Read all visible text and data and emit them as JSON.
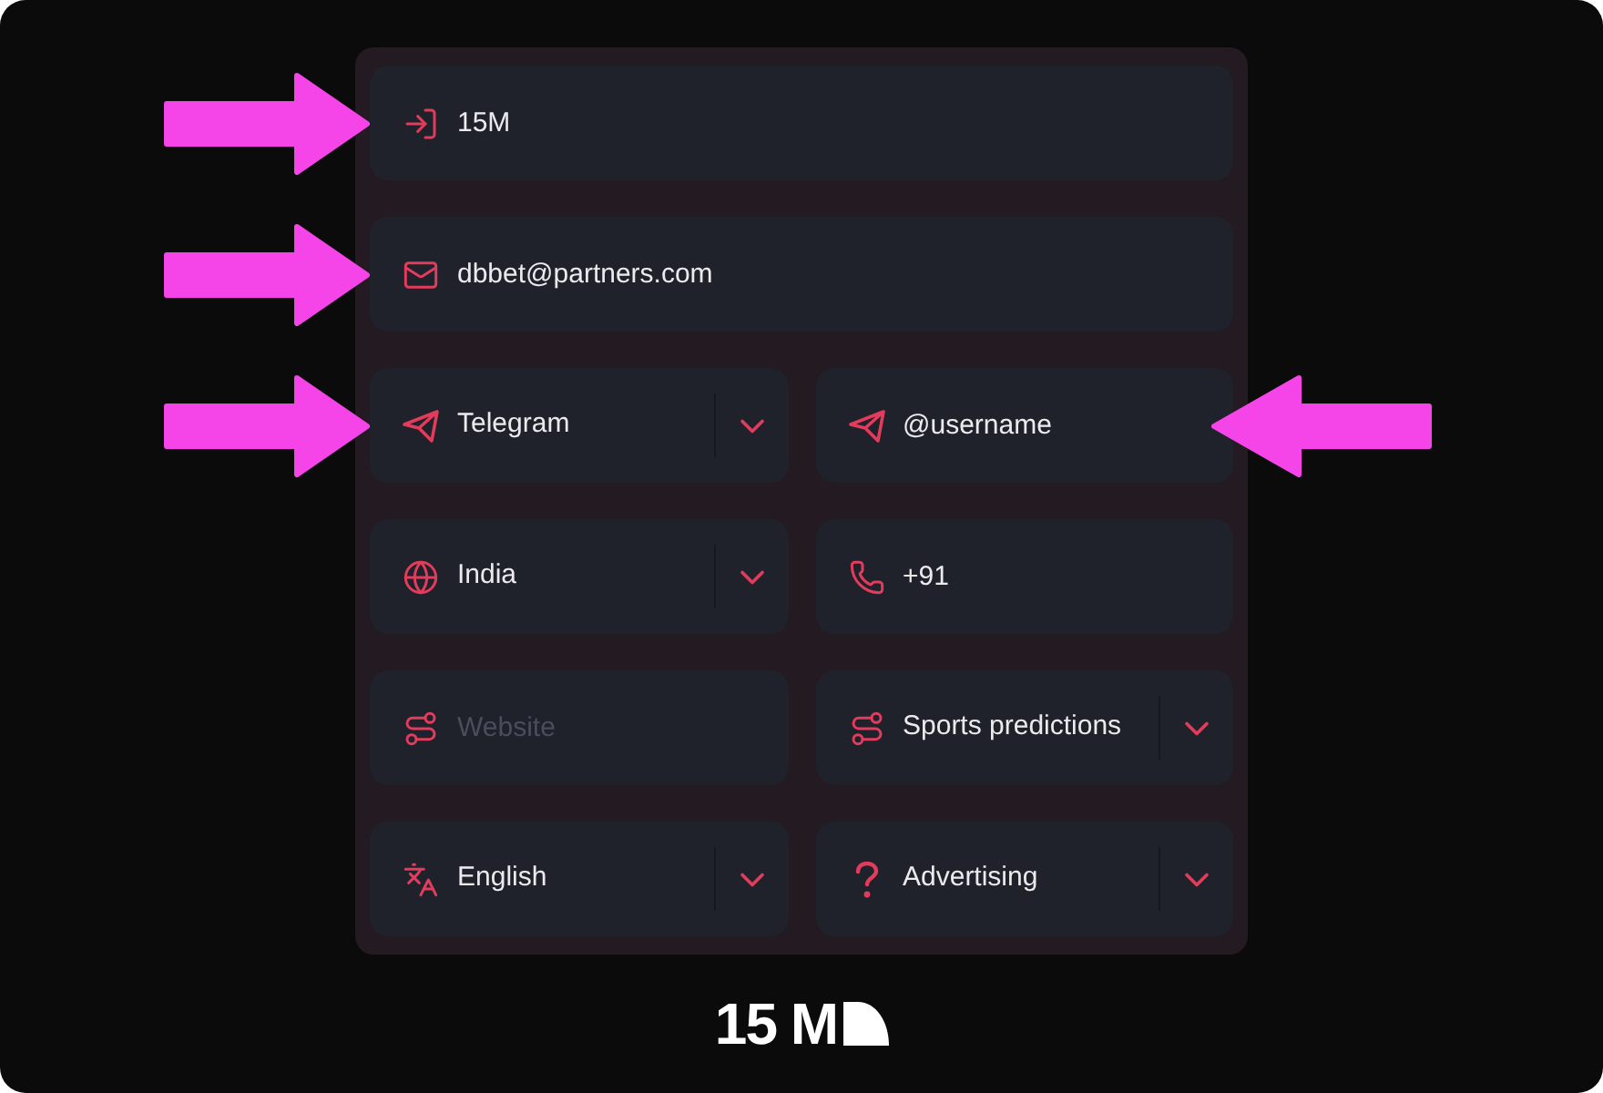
{
  "form": {
    "rows": [
      {
        "fields": [
          {
            "kind": "input",
            "value": "15M",
            "arrow_left": true,
            "arrow_right": false
          }
        ]
      },
      {
        "fields": [
          {
            "kind": "input",
            "value": "dbbet@partners.com",
            "arrow_left": true,
            "arrow_right": false
          }
        ]
      },
      {
        "fields": [
          {
            "kind": "select",
            "value": "Telegram",
            "arrow_left": true,
            "arrow_right": false
          },
          {
            "kind": "input",
            "value": "@username",
            "arrow_left": false,
            "arrow_right": true
          }
        ]
      },
      {
        "fields": [
          {
            "kind": "select",
            "value": "India",
            "arrow_left": false,
            "arrow_right": false
          },
          {
            "kind": "input",
            "value": "+91",
            "arrow_left": false,
            "arrow_right": false
          }
        ]
      },
      {
        "fields": [
          {
            "kind": "input",
            "placeholder": "Website",
            "arrow_left": false,
            "arrow_right": false
          },
          {
            "kind": "select",
            "value": "Sports predictions",
            "arrow_left": false,
            "arrow_right": false
          }
        ]
      },
      {
        "fields": [
          {
            "kind": "select",
            "value": "English",
            "arrow_left": false,
            "arrow_right": false
          },
          {
            "kind": "select",
            "value": "Advertising",
            "arrow_left": false,
            "arrow_right": false
          }
        ]
      }
    ]
  },
  "logo": {
    "text": "15 M"
  }
}
